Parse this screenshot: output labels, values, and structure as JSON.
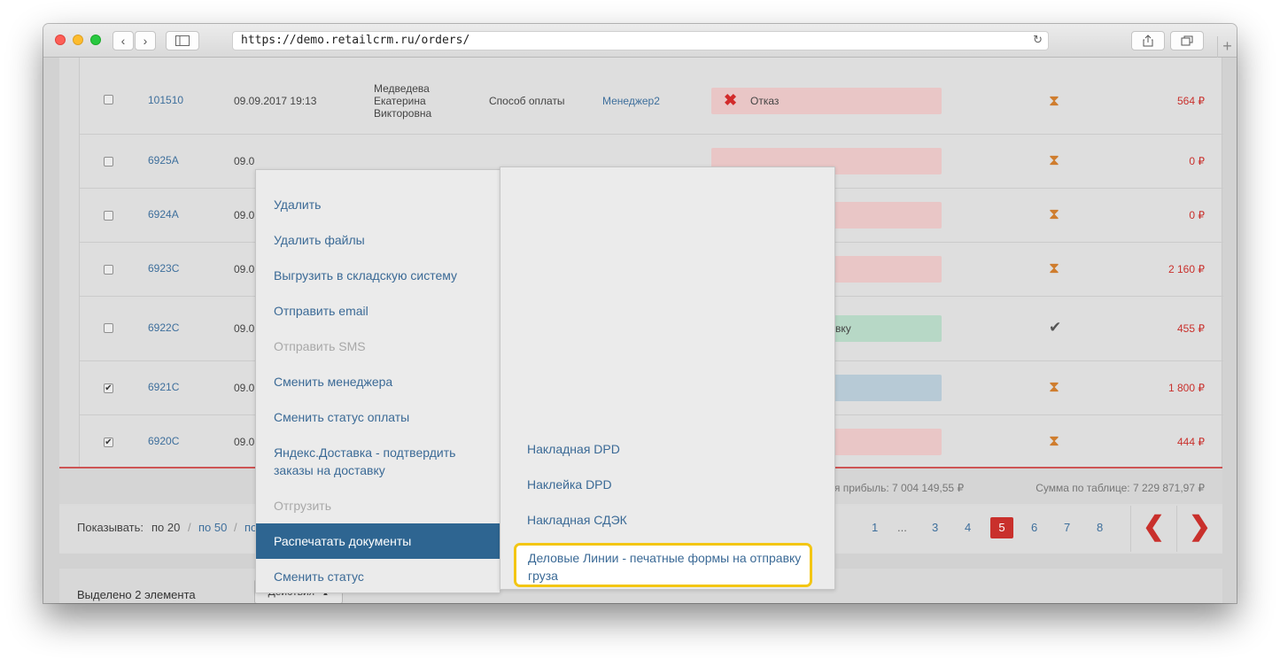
{
  "browser": {
    "url": "https://demo.retailcrm.ru/orders/",
    "back_glyph": "‹",
    "forward_glyph": "›",
    "reload_glyph": "↻",
    "newtab_glyph": "+",
    "icons": [
      "back-icon",
      "forward-icon",
      "sidebar-icon",
      "reload-icon",
      "share-icon",
      "tabs-icon"
    ]
  },
  "orders": [
    {
      "checked": false,
      "number": "101510",
      "date": "09.09.2017 19:13",
      "customer": [
        "Медведева",
        "Екатерина",
        "Викторовна"
      ],
      "payment": "Способ оплаты",
      "manager": "Менеджер2",
      "status": "Отказ",
      "status_icon": "✖",
      "status_color": "#e9c6c6",
      "flag": "⧗",
      "sum": "564 ₽"
    },
    {
      "checked": false,
      "number": "6925A",
      "date": "09.0",
      "status_color": "#e9c6c6",
      "flag": "⧗",
      "sum": "0 ₽"
    },
    {
      "checked": false,
      "number": "6924A",
      "date": "09.0",
      "status_color": "#e9c6c6",
      "flag": "⧗",
      "sum": "0 ₽"
    },
    {
      "checked": false,
      "number": "6923C",
      "date": "09.0",
      "status_color": "#e9c6c6",
      "flag": "⧗",
      "sum": "2 160 ₽"
    },
    {
      "checked": false,
      "number": "6922C",
      "date": "09.0",
      "status": "вку",
      "status_color": "#b7d8c6",
      "flag": "✔",
      "sum": "455 ₽"
    },
    {
      "checked": true,
      "number": "6921C",
      "date": "09.0",
      "status_color": "#b7cad6",
      "flag": "⧗",
      "sum": "1 800 ₽"
    },
    {
      "checked": true,
      "number": "6920C",
      "date": "09.0",
      "status_color": "#e9c6c6",
      "flag": "⧗",
      "sum": "444 ₽"
    }
  ],
  "checkmark": "✔",
  "totals": {
    "profit": "вая прибыль: 7 004 149,55 ₽",
    "table_sum": "Сумма по таблице: 7 229 871,97 ₽"
  },
  "pager": {
    "show_label": "Показывать:",
    "per_page_current": "по 20",
    "sep": "/",
    "per_page_50": "по 50",
    "per_page_cut": "по",
    "pages": [
      "1",
      "...",
      "3",
      "4",
      "5",
      "6",
      "7",
      "8"
    ],
    "active_page": "5",
    "prev_glyph": "❮",
    "next_glyph": "❯"
  },
  "bottom_bar": {
    "selected_text": "Выделено 2 элемента",
    "actions_label": "Действия",
    "actions_caret": "▲"
  },
  "actions_menu": [
    {
      "label": "Удалить",
      "state": "normal"
    },
    {
      "label": "Удалить файлы",
      "state": "normal"
    },
    {
      "label": "Выгрузить в складскую систему",
      "state": "normal"
    },
    {
      "label": "Отправить email",
      "state": "normal"
    },
    {
      "label": "Отправить SMS",
      "state": "disabled"
    },
    {
      "label": "Сменить менеджера",
      "state": "normal"
    },
    {
      "label": "Сменить статус оплаты",
      "state": "normal"
    },
    {
      "label": "Яндекс.Доставка - подтвердить заказы на доставку",
      "state": "normal"
    },
    {
      "label": "Отгрузить",
      "state": "disabled"
    },
    {
      "label": "Распечатать документы",
      "state": "selected"
    },
    {
      "label": "Сменить статус",
      "state": "normal"
    }
  ],
  "print_submenu": [
    "Накладная DPD",
    "Наклейка DPD",
    "Накладная СДЭК",
    "Деловые Линии - печатные формы на отправку груза"
  ],
  "colors": {
    "link": "#3b6a96",
    "accent": "#c9302c",
    "menu_selected": "#2e6591",
    "highlight_border": "#f3c614"
  }
}
